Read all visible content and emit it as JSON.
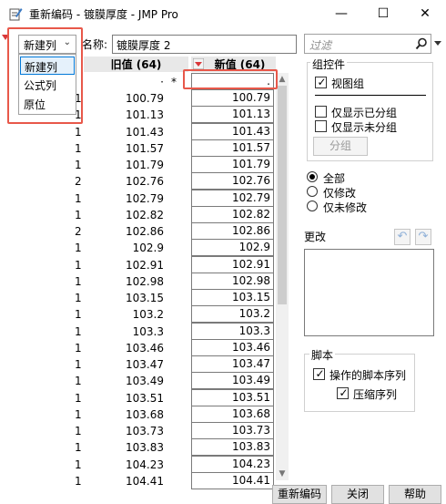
{
  "window": {
    "title": "重新编码 - 镀膜厚度 - JMP Pro",
    "min_glyph": "—",
    "max_glyph": "☐",
    "close_glyph": "✕"
  },
  "toolbar": {
    "dropdown_value": "新建列",
    "name_label": "名称:",
    "name_value": "镀膜厚度 2",
    "filter_placeholder": "过滤"
  },
  "dropdown_options": [
    "新建列",
    "公式列",
    "原位"
  ],
  "table": {
    "old_header": "旧值 (64)",
    "new_header": "新值 (64)",
    "missing_old": "·",
    "missing_asterisk": "*",
    "missing_new": ".",
    "rows": [
      {
        "count": "1",
        "old": "100.79",
        "new": "100.79"
      },
      {
        "count": "1",
        "old": "101.13",
        "new": "101.13"
      },
      {
        "count": "1",
        "old": "101.43",
        "new": "101.43"
      },
      {
        "count": "1",
        "old": "101.57",
        "new": "101.57"
      },
      {
        "count": "1",
        "old": "101.79",
        "new": "101.79"
      },
      {
        "count": "2",
        "old": "102.76",
        "new": "102.76"
      },
      {
        "count": "1",
        "old": "102.79",
        "new": "102.79"
      },
      {
        "count": "1",
        "old": "102.82",
        "new": "102.82"
      },
      {
        "count": "2",
        "old": "102.86",
        "new": "102.86"
      },
      {
        "count": "1",
        "old": "102.9",
        "new": "102.9"
      },
      {
        "count": "1",
        "old": "102.91",
        "new": "102.91"
      },
      {
        "count": "1",
        "old": "102.98",
        "new": "102.98"
      },
      {
        "count": "1",
        "old": "103.15",
        "new": "103.15"
      },
      {
        "count": "1",
        "old": "103.2",
        "new": "103.2"
      },
      {
        "count": "1",
        "old": "103.3",
        "new": "103.3"
      },
      {
        "count": "1",
        "old": "103.46",
        "new": "103.46"
      },
      {
        "count": "1",
        "old": "103.47",
        "new": "103.47"
      },
      {
        "count": "1",
        "old": "103.49",
        "new": "103.49"
      },
      {
        "count": "1",
        "old": "103.51",
        "new": "103.51"
      },
      {
        "count": "1",
        "old": "103.68",
        "new": "103.68"
      },
      {
        "count": "1",
        "old": "103.73",
        "new": "103.73"
      },
      {
        "count": "1",
        "old": "103.83",
        "new": "103.83"
      },
      {
        "count": "1",
        "old": "104.23",
        "new": "104.23"
      },
      {
        "count": "1",
        "old": "104.41",
        "new": "104.41"
      }
    ]
  },
  "group_panel": {
    "title": "组控件",
    "view_group": "视图组",
    "view_group_checked": true,
    "show_grouped": "仅显示已分组",
    "show_grouped_checked": false,
    "show_ungrouped": "仅显示未分组",
    "show_ungrouped_checked": false,
    "group_button": "分组"
  },
  "radios": {
    "all": "全部",
    "modified": "仅修改",
    "unmodified": "仅未修改",
    "selected": "all"
  },
  "changes": {
    "label": "更改",
    "undo_glyph": "↶",
    "redo_glyph": "↷"
  },
  "script_panel": {
    "title": "脚本",
    "action_script": "操作的脚本序列",
    "action_script_checked": true,
    "compress": "压缩序列",
    "compress_checked": true
  },
  "buttons": {
    "recode": "重新编码",
    "close": "关闭",
    "help": "帮助"
  },
  "colors": {
    "highlight_outline": "#e8584a",
    "selection_border": "#0078d7",
    "sort_arrow": "#d9383a"
  }
}
